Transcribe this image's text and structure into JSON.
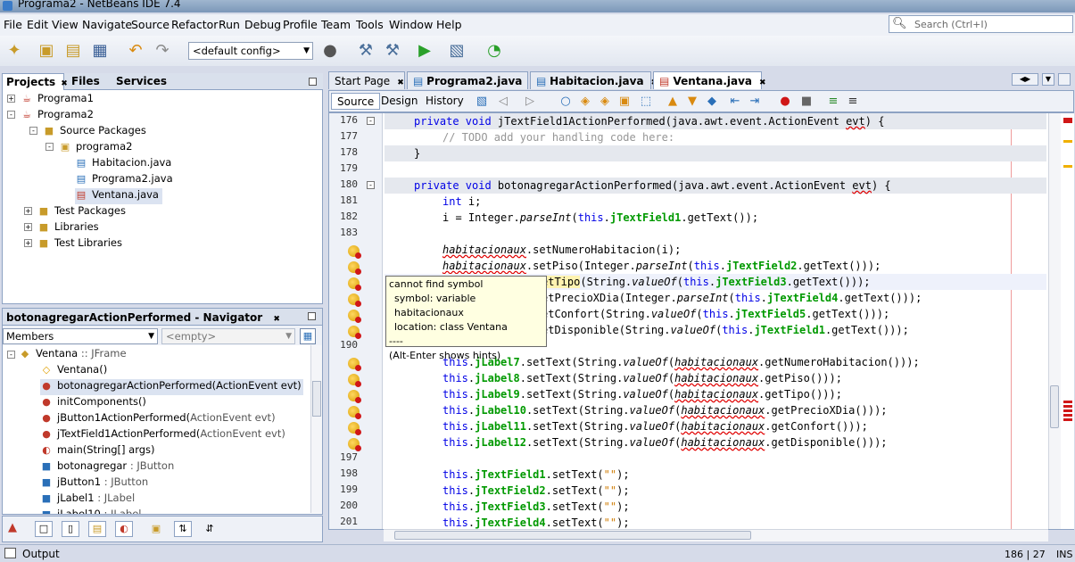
{
  "window": {
    "title": "Programa2 - NetBeans IDE 7.4"
  },
  "menu": [
    "File",
    "Edit",
    "View",
    "Navigate",
    "Source",
    "Refactor",
    "Run",
    "Debug",
    "Profile",
    "Team",
    "Tools",
    "Window",
    "Help"
  ],
  "search": {
    "placeholder": "Search (Ctrl+I)"
  },
  "toolbar": {
    "config": "<default config>"
  },
  "projects_panel": {
    "tabs": [
      "Projects",
      "Files",
      "Services"
    ],
    "tree": [
      "Programa1",
      "Programa2",
      "Source Packages",
      "programa2",
      "Habitacion.java",
      "Programa2.java",
      "Ventana.java",
      "Test Packages",
      "Libraries",
      "Test Libraries"
    ]
  },
  "navigator": {
    "title": "botonagregarActionPerformed - Navigator",
    "filter": "Members",
    "filter2": "<empty>",
    "root": "Ventana",
    "root_type": ":: JFrame",
    "items": [
      {
        "name": "Ventana()",
        "type": ""
      },
      {
        "name": "botonagregarActionPerformed(ActionEvent evt)",
        "type": ""
      },
      {
        "name": "initComponents()",
        "type": ""
      },
      {
        "name": "jButton1ActionPerformed(",
        "type": "ActionEvent evt)"
      },
      {
        "name": "jTextField1ActionPerformed(",
        "type": "ActionEvent evt)"
      },
      {
        "name": "main(String[] args)",
        "type": ""
      },
      {
        "name": "botonagregar",
        "type": ": JButton"
      },
      {
        "name": "jButton1",
        "type": ": JButton"
      },
      {
        "name": "jLabel1",
        "type": ": JLabel"
      },
      {
        "name": "jLabel10",
        "type": ": JLabel"
      }
    ]
  },
  "editor": {
    "tabs": [
      "Start Page",
      "Programa2.java",
      "Habitacion.java",
      "Ventana.java"
    ],
    "views": [
      "Source",
      "Design",
      "History"
    ],
    "line_numbers": [
      "176",
      "177",
      "178",
      "179",
      "180",
      "181",
      "182",
      "183",
      "",
      "",
      "",
      "",
      "",
      "",
      "190",
      "",
      "",
      "",
      "",
      "",
      "",
      "197",
      "198",
      "199",
      "200",
      "201"
    ]
  },
  "code": {
    "l176": {
      "a": "private void",
      "b": " jTextField1ActionPerformed(java.awt.event.ActionEvent ",
      "c": "evt",
      "d": ") {"
    },
    "l177": "// TODO add your handling code here:",
    "l178": "}",
    "l180": {
      "a": "private void",
      "b": " botonagregarActionPerformed(java.awt.event.ActionEvent ",
      "c": "evt",
      "d": ") {"
    },
    "l181": {
      "a": "int",
      "b": " i;"
    },
    "l182": {
      "a": "i = Integer.",
      "b": "parseInt",
      "c": "(",
      "d": "this",
      "e": ".",
      "f": "jTextField1",
      "g": ".getText());"
    },
    "l184": {
      "a": "habitacionaux",
      "b": ".setNumeroHabitacion(i);"
    },
    "l185": {
      "a": "habitacionaux",
      "b": ".setPiso(Integer.",
      "c": "parseInt",
      "d": "(",
      "e": "this",
      "f": ".",
      "g": "jTextField2",
      "h": ".getText()));"
    },
    "l186": {
      "a": "etTipo",
      "b": "(String.",
      "c": "valueOf",
      "d": "(",
      "e": "this",
      "f": ".",
      "g": "jTextField3",
      "h": ".getText()));"
    },
    "l187": {
      "a": "etPrecioXDia",
      "b": "(Integer.",
      "c": "parseInt",
      "d": "(",
      "e": "this",
      "f": ".",
      "g": "jTextField4",
      "h": ".getText()));"
    },
    "l188": {
      "a": "etConfort",
      "b": "(String.",
      "c": "valueOf",
      "d": "(",
      "e": "this",
      "f": ".",
      "g": "jTextField5",
      "h": ".getText()));"
    },
    "l189": {
      "a": "etDisponible",
      "b": "(String.",
      "c": "valueOf",
      "d": "(",
      "e": "this",
      "f": ".",
      "g": "jTextField1",
      "h": ".getText()));"
    },
    "l191": {
      "a": "this",
      "b": ".",
      "c": "jLabel7",
      "d": ".setText(String.",
      "e": "valueOf",
      "f": "(",
      "g": "habitacionaux",
      "h": ".getNumeroHabitacion()));"
    },
    "l192": {
      "a": "this",
      "b": ".",
      "c": "jLabel8",
      "d": ".setText(String.",
      "e": "valueOf",
      "f": "(",
      "g": "habitacionaux",
      "h": ".getPiso()));"
    },
    "l193": {
      "a": "this",
      "b": ".",
      "c": "jLabel9",
      "d": ".setText(String.",
      "e": "valueOf",
      "f": "(",
      "g": "habitacionaux",
      "h": ".getTipo()));"
    },
    "l194": {
      "a": "this",
      "b": ".",
      "c": "jLabel10",
      "d": ".setText(String.",
      "e": "valueOf",
      "f": "(",
      "g": "habitacionaux",
      "h": ".getPrecioXDia()));"
    },
    "l195": {
      "a": "this",
      "b": ".",
      "c": "jLabel11",
      "d": ".setText(String.",
      "e": "valueOf",
      "f": "(",
      "g": "habitacionaux",
      "h": ".getConfort()));"
    },
    "l196": {
      "a": "this",
      "b": ".",
      "c": "jLabel12",
      "d": ".setText(String.",
      "e": "valueOf",
      "f": "(",
      "g": "habitacionaux",
      "h": ".getDisponible()));"
    },
    "l198": {
      "a": "this",
      "b": ".",
      "c": "jTextField1",
      "d": ".setText(",
      "e": "\"\"",
      "f": ");"
    },
    "l199": {
      "a": "this",
      "b": ".",
      "c": "jTextField2",
      "d": ".setText(",
      "e": "\"\"",
      "f": ");"
    },
    "l200": {
      "a": "this",
      "b": ".",
      "c": "jTextField3",
      "d": ".setText(",
      "e": "\"\"",
      "f": ");"
    },
    "l201": {
      "a": "this",
      "b": ".",
      "c": "jTextField4",
      "d": ".setText(",
      "e": "\"\"",
      "f": ");"
    }
  },
  "tooltip": {
    "line1": "cannot find symbol",
    "line2": "symbol:   variable habitacionaux",
    "line3": "location: class Ventana",
    "line4": "----",
    "line5": "(Alt-Enter shows hints)"
  },
  "status": {
    "output": "Output",
    "position": "186 | 27",
    "mode": "INS"
  },
  "colors": {
    "keyword": "#0000e6",
    "field": "#009900",
    "comment": "#969696",
    "string": "#ce7b00",
    "error": "#d01717"
  }
}
